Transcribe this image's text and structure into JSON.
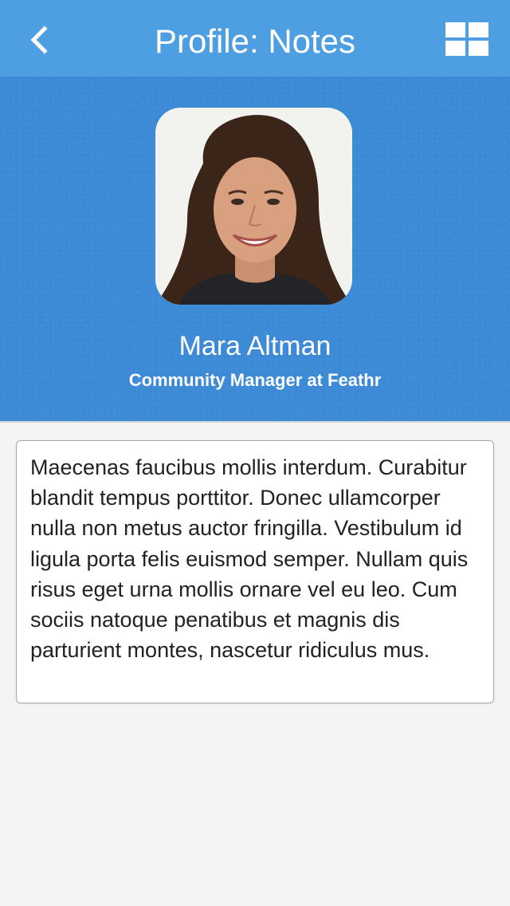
{
  "navbar": {
    "title": "Profile: Notes",
    "back_icon": "chevron-left-icon",
    "menu_icon": "grid-icon",
    "background_color": "#4e9ee2"
  },
  "profile": {
    "name": "Mara Altman",
    "role": "Community Manager at Feathr",
    "header_color": "#3d8ad6"
  },
  "notes": {
    "text": "Maecenas faucibus mollis interdum. Curabitur blandit tempus porttitor. Donec ullamcorper nulla non metus auctor fringilla. Vestibulum id ligula porta felis euismod semper. Nullam quis risus eget urna mollis ornare vel eu leo. Cum sociis natoque penatibus et magnis dis parturient montes, nascetur ridiculus mus."
  }
}
